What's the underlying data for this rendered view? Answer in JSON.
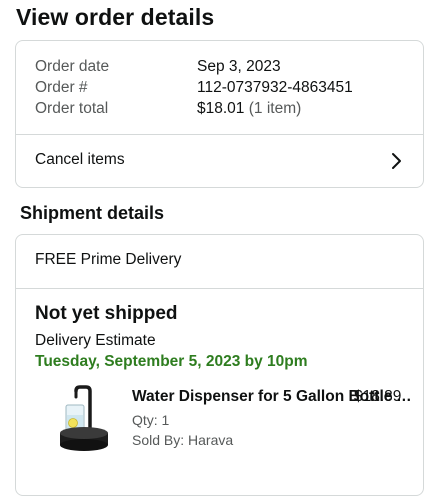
{
  "page": {
    "title": "View order details"
  },
  "order_summary": {
    "rows": [
      {
        "label": "Order date",
        "value": "Sep 3, 2023"
      },
      {
        "label": "Order #",
        "value": "112-0737932-4863451"
      },
      {
        "label": "Order total",
        "value": "$18.01",
        "extra": "(1 item)"
      }
    ],
    "cancel_label": "Cancel items"
  },
  "shipment": {
    "section_title": "Shipment details",
    "delivery_type": "FREE Prime Delivery",
    "status": "Not yet shipped",
    "estimate_label": "Delivery Estimate",
    "estimate_date": "Tuesday, September 5, 2023 by 10pm",
    "item": {
      "title": "Water Dispenser for 5 Gallon Bottle Aut...",
      "price": "$18.89",
      "qty": "Qty: 1",
      "seller": "Sold By: Harava",
      "image": "water-dispenser-product-image"
    }
  },
  "colors": {
    "estimate_green": "#2e7d1f",
    "muted": "#565959",
    "border": "#d5d9d9"
  }
}
